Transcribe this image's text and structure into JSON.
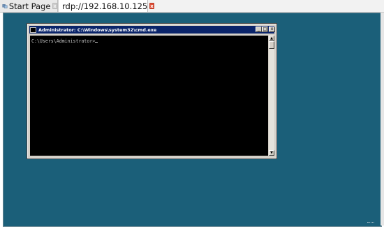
{
  "tabs": [
    {
      "label": "Start Page",
      "icon": "page-icon",
      "close": "x"
    },
    {
      "label": "rdp://192.168.10.125",
      "icon": "rdp-icon",
      "close": "x"
    }
  ],
  "window": {
    "title": "Administrator: C:\\Windows\\system32\\cmd.exe",
    "buttons": {
      "minimize": "_",
      "maximize": "□",
      "close": "x"
    }
  },
  "console": {
    "prompt": "C:\\Users\\Administrator>"
  },
  "scrollbar": {
    "up": "▲",
    "down": "▼"
  },
  "colors": {
    "desktop": "#1b5f79",
    "titlebar": "#0a246a",
    "console_bg": "#000000",
    "console_fg": "#c0c0c0",
    "tab_close_active": "#e0523a"
  }
}
